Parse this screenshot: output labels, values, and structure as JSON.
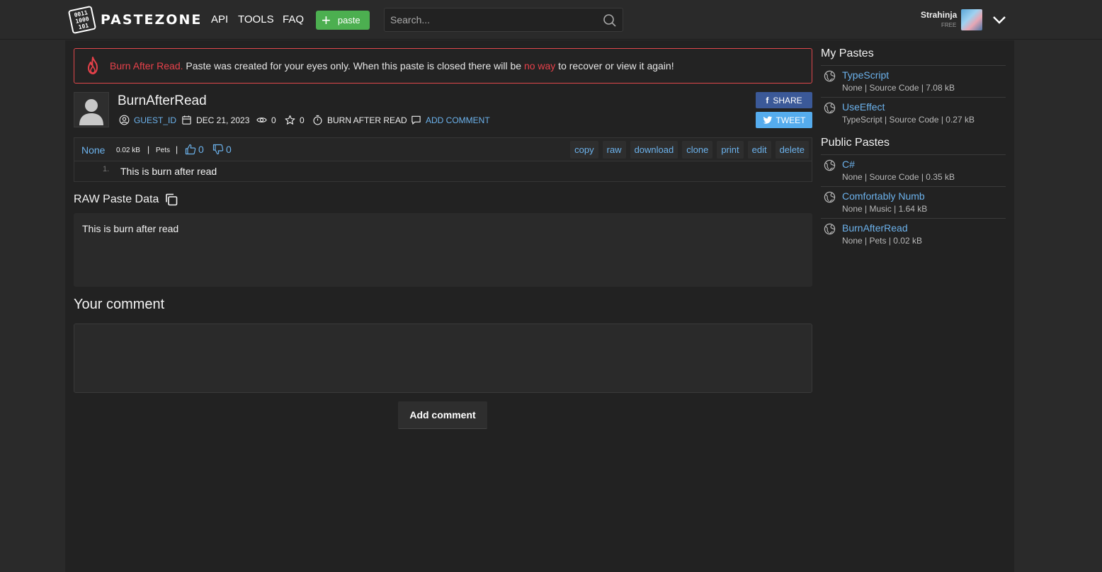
{
  "header": {
    "logo_text": "PASTEZONE",
    "logo_mark_lines": [
      "0011",
      "1000",
      "101"
    ],
    "nav": {
      "api": "API",
      "tools": "TOOLS",
      "faq": "FAQ"
    },
    "new_paste_label": "paste",
    "search_placeholder": "Search...",
    "user": {
      "name": "Strahinja",
      "plan": "FREE"
    }
  },
  "alert": {
    "title": "Burn After Read.",
    "text_a": " Paste was created for your eyes only. When this paste is closed there will be ",
    "highlight": "no way",
    "text_b": " to recover or view it again!"
  },
  "paste": {
    "title": "BurnAfterRead",
    "author": "GUEST_ID",
    "date": "DEC 21, 2023",
    "views": "0",
    "stars": "0",
    "expiry": "BURN AFTER READ",
    "add_comment": "ADD COMMENT",
    "share_label": "SHARE",
    "tweet_label": "TWEET",
    "syntax": "None",
    "size": "0.02 kB",
    "category": "Pets",
    "separator": "|",
    "likes": "0",
    "dislikes": "0",
    "tools": {
      "copy": "copy",
      "raw": "raw",
      "download": "download",
      "clone": "clone",
      "print": "print",
      "edit": "edit",
      "delete": "delete"
    },
    "lines": [
      {
        "no": "1.",
        "text": "This is burn after read"
      }
    ]
  },
  "raw": {
    "title": "RAW Paste Data",
    "content": "This is burn after read"
  },
  "comment": {
    "title": "Your comment",
    "value": "",
    "button": "Add comment"
  },
  "sidebar": {
    "my_title": "My Pastes",
    "my_pastes": [
      {
        "title": "TypeScript",
        "meta": "None | Source Code | 7.08 kB"
      },
      {
        "title": "UseEffect",
        "meta": "TypeScript | Source Code | 0.27 kB"
      }
    ],
    "public_title": "Public Pastes",
    "public_pastes": [
      {
        "title": "C#",
        "meta": "None | Source Code | 0.35 kB"
      },
      {
        "title": "Comfortably Numb",
        "meta": "None | Music | 1.64 kB"
      },
      {
        "title": "BurnAfterRead",
        "meta": "None | Pets | 0.02 kB"
      }
    ]
  },
  "colors": {
    "accent_link": "#6cb2ec",
    "burn_red": "#e6414a",
    "new_paste_green": "#4caf50",
    "facebook": "#3b5998",
    "twitter": "#55acee"
  }
}
